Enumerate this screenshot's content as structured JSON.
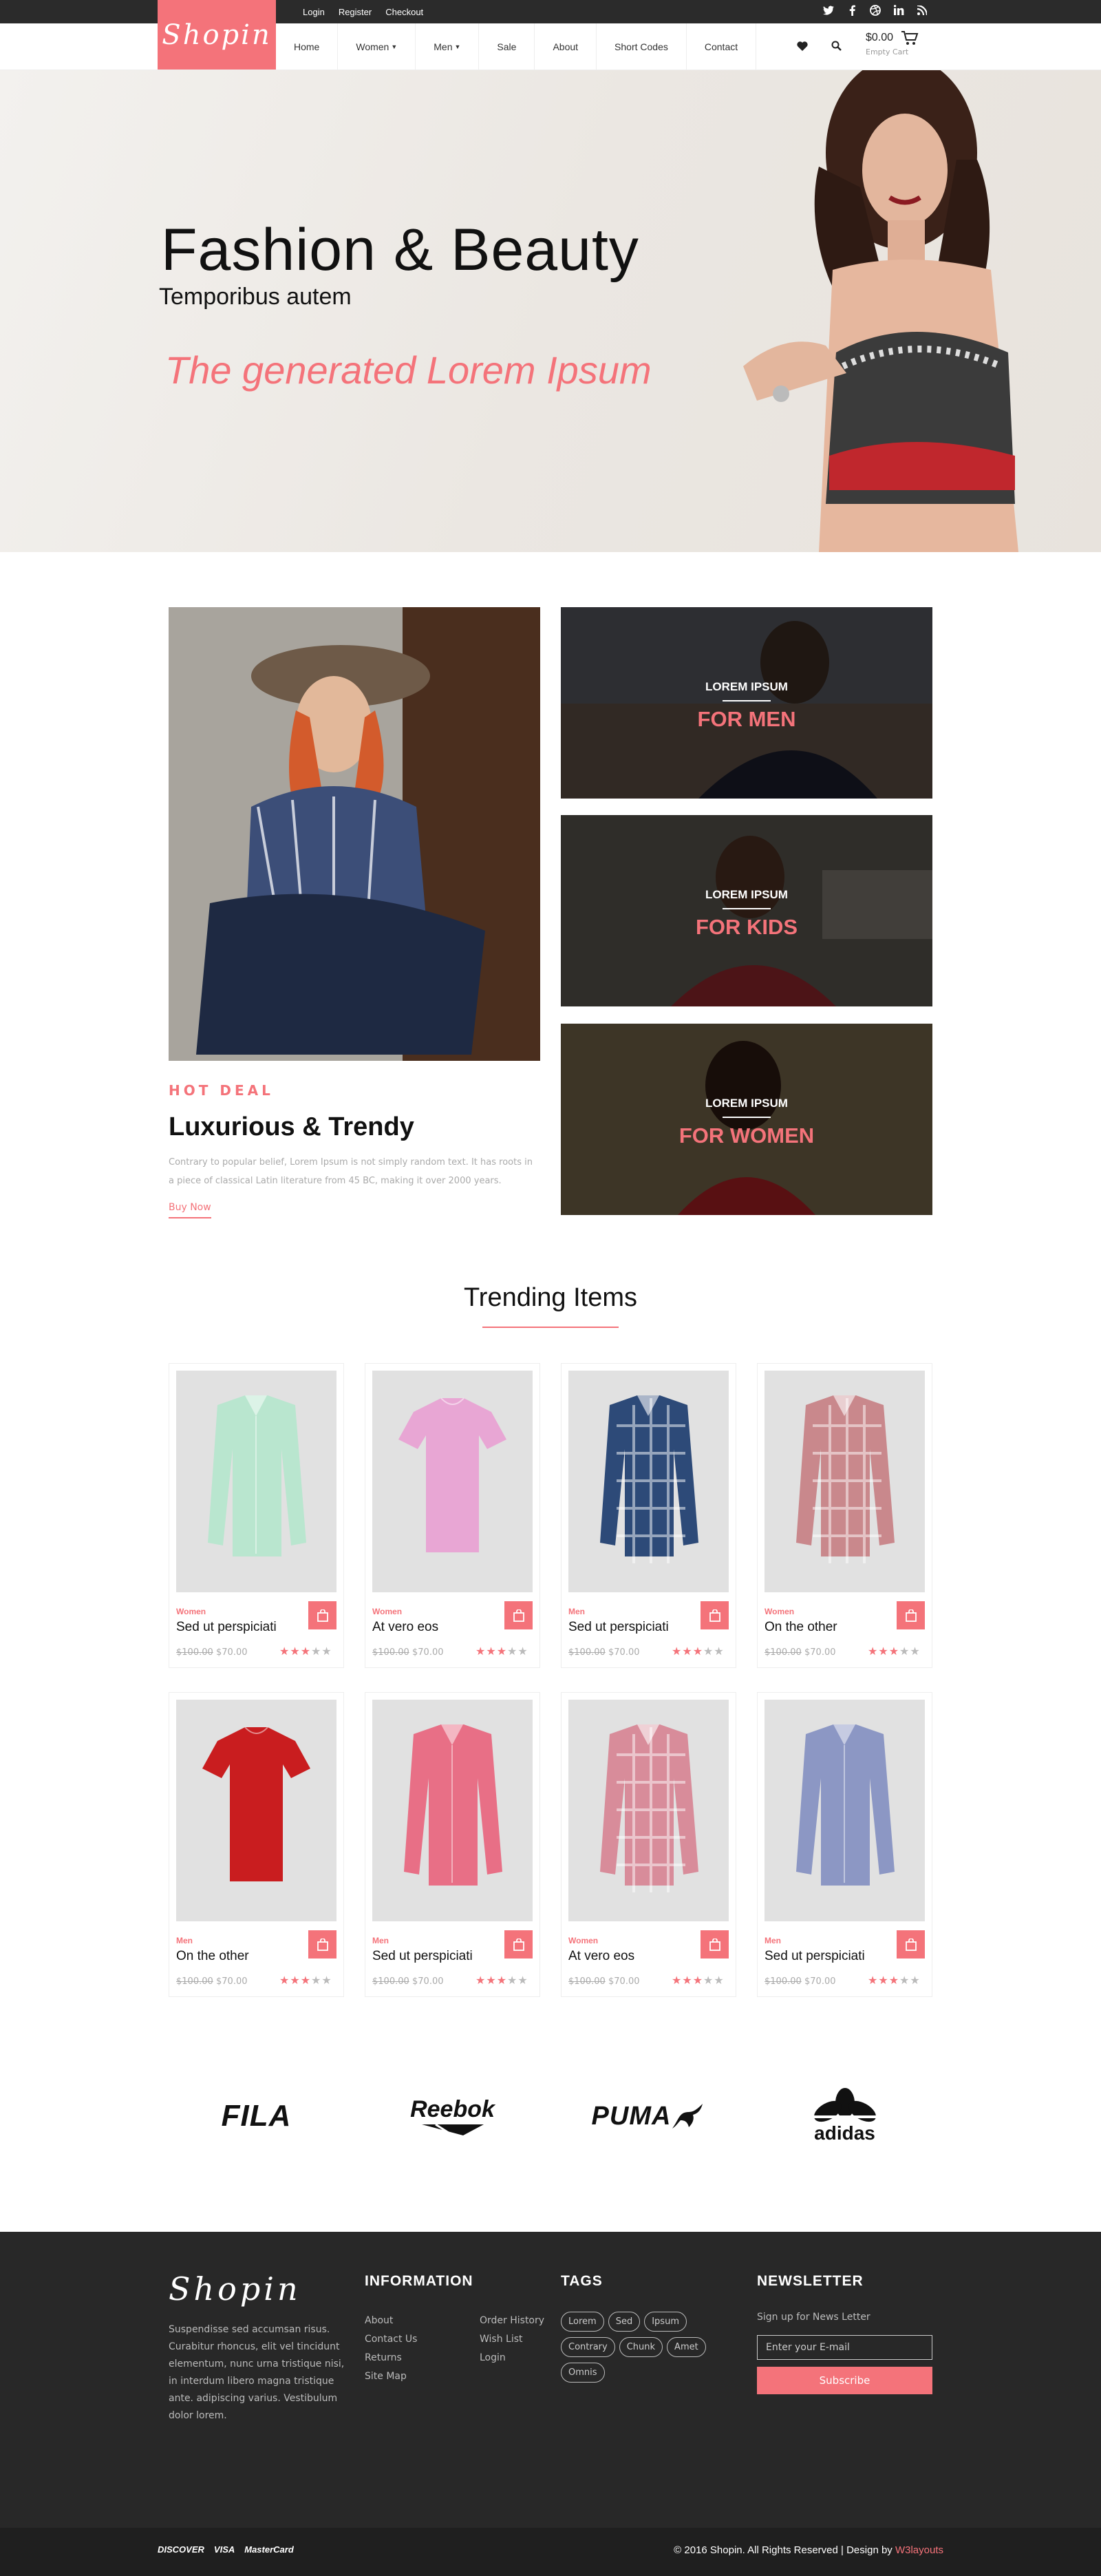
{
  "topbar": {
    "links": [
      "Login",
      "Register",
      "Checkout"
    ],
    "social_icons": [
      "twitter-icon",
      "facebook-icon",
      "dribbble-icon",
      "linkedin-icon",
      "rss-icon"
    ]
  },
  "header": {
    "logo": "Shopin",
    "nav": [
      "Home",
      "Women",
      "Men",
      "Sale",
      "About",
      "Short Codes",
      "Contact"
    ],
    "cart_amount": "$0.00",
    "cart_status": "Empty Cart"
  },
  "hero": {
    "title": "Fashion & Beauty",
    "subtitle": "Temporibus autem",
    "tagline": "The generated Lorem Ipsum"
  },
  "deal": {
    "label": "HOT DEAL",
    "title": "Luxurious & Trendy",
    "text": "Contrary to popular belief, Lorem Ipsum is not simply random text. It has roots in a piece of classical Latin literature from 45 BC, making it over 2000 years.",
    "cta": "Buy Now"
  },
  "categories": [
    {
      "label": "LOREM IPSUM",
      "title": "FOR MEN"
    },
    {
      "label": "LOREM IPSUM",
      "title": "FOR KIDS"
    },
    {
      "label": "LOREM IPSUM",
      "title": "FOR WOMEN"
    }
  ],
  "trending": {
    "title": "Trending Items",
    "products": [
      {
        "category": "Women",
        "name": "Sed ut perspiciati",
        "old_price": "$100.00",
        "price": "$70.00",
        "rating": 2.5,
        "color": "#b9e6cf",
        "kind": "shirt"
      },
      {
        "category": "Women",
        "name": "At vero eos",
        "old_price": "$100.00",
        "price": "$70.00",
        "rating": 2.5,
        "color": "#e8a6d4",
        "kind": "tee"
      },
      {
        "category": "Men",
        "name": "Sed ut perspiciati",
        "old_price": "$100.00",
        "price": "$70.00",
        "rating": 2.5,
        "color": "#2d4a78",
        "kind": "plaid"
      },
      {
        "category": "Women",
        "name": "On the other",
        "old_price": "$100.00",
        "price": "$70.00",
        "rating": 2.5,
        "color": "#c9888c",
        "kind": "plaid"
      },
      {
        "category": "Men",
        "name": "On the other",
        "old_price": "$100.00",
        "price": "$70.00",
        "rating": 2.5,
        "color": "#c91d1f",
        "kind": "tee"
      },
      {
        "category": "Men",
        "name": "Sed ut perspiciati",
        "old_price": "$100.00",
        "price": "$70.00",
        "rating": 2.5,
        "color": "#e86f86",
        "kind": "shirt"
      },
      {
        "category": "Women",
        "name": "At vero eos",
        "old_price": "$100.00",
        "price": "$70.00",
        "rating": 2.5,
        "color": "#d88c9a",
        "kind": "plaid"
      },
      {
        "category": "Men",
        "name": "Sed ut perspiciati",
        "old_price": "$100.00",
        "price": "$70.00",
        "rating": 2.5,
        "color": "#8c97c4",
        "kind": "shirt"
      }
    ]
  },
  "brands": [
    "FILA",
    "Reebok",
    "PUMA",
    "adidas"
  ],
  "footer": {
    "logo": "Shopin",
    "about": "Suspendisse sed accumsan risus. Curabitur rhoncus, elit vel tincidunt elementum, nunc urna tristique nisi, in interdum libero magna tristique ante. adipiscing varius. Vestibulum dolor lorem.",
    "information_title": "INFORMATION",
    "info_col1": [
      "About",
      "Contact Us",
      "Returns",
      "Site Map"
    ],
    "info_col2": [
      "Order History",
      "Wish List",
      "Login"
    ],
    "tags_title": "TAGS",
    "tags": [
      "Lorem",
      "Sed",
      "Ipsum",
      "Contrary",
      "Chunk",
      "Amet",
      "Omnis"
    ],
    "newsletter_title": "NEWSLETTER",
    "newsletter_label": "Sign up for News Letter",
    "newsletter_placeholder": "Enter your E-mail",
    "subscribe": "Subscribe",
    "payment": [
      "DISCOVER",
      "VISA",
      "MasterCard"
    ],
    "copyright": "© 2016 Shopin. All Rights Reserved | Design by",
    "designer": "W3layouts"
  },
  "colors": {
    "accent": "#f4737a",
    "dark": "#282828"
  }
}
